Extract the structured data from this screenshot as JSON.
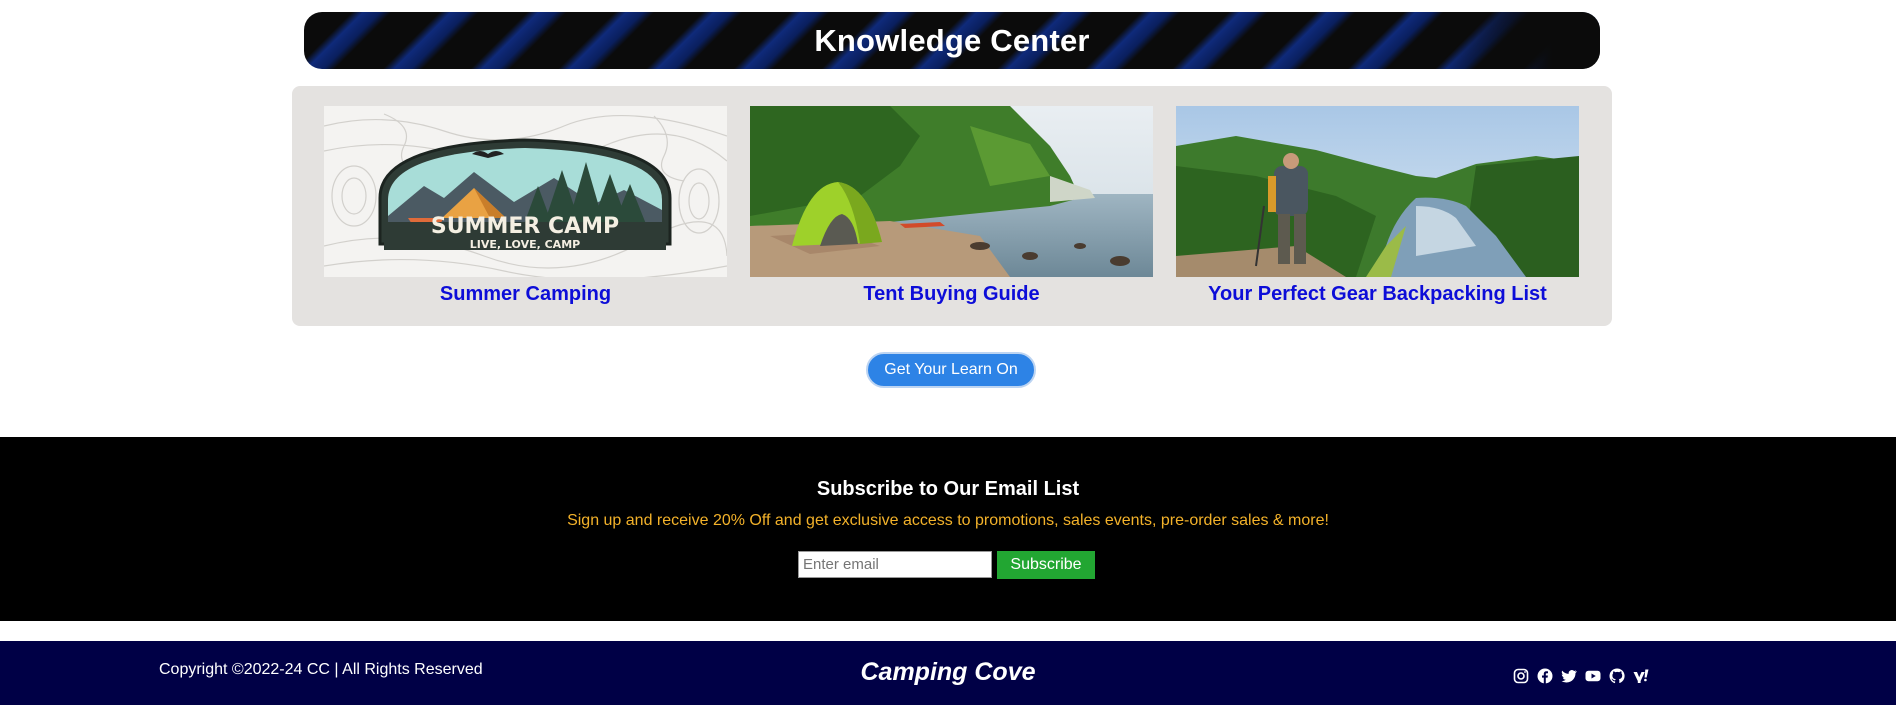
{
  "banner": {
    "title": "Knowledge Center"
  },
  "cards": [
    {
      "caption": "Summer Camping",
      "image_text_main": "SUMMER CAMP",
      "image_text_sub": "LIVE, LOVE, CAMP"
    },
    {
      "caption": "Tent Buying Guide"
    },
    {
      "caption": "Your Perfect Gear Backpacking List"
    }
  ],
  "learn_button": {
    "label": "Get Your Learn On"
  },
  "subscribe": {
    "title": "Subscribe to Our Email List",
    "text": "Sign up and receive 20% Off and get exclusive access to promotions, sales events, pre-order sales & more!",
    "placeholder": "Enter email",
    "button_label": "Subscribe"
  },
  "footer": {
    "copyright": "Copyright ©2022-24 CC | All Rights Reserved",
    "brand": "Camping Cove",
    "social_icons": [
      "instagram-icon",
      "facebook-icon",
      "twitter-icon",
      "youtube-icon",
      "github-icon",
      "yahoo-icon"
    ]
  },
  "colors": {
    "link": "#0d0dd8",
    "button_blue": "#2d83e6",
    "subscribe_green": "#22a632",
    "footer_navy": "#000046",
    "promo_text": "#f3b22a"
  }
}
